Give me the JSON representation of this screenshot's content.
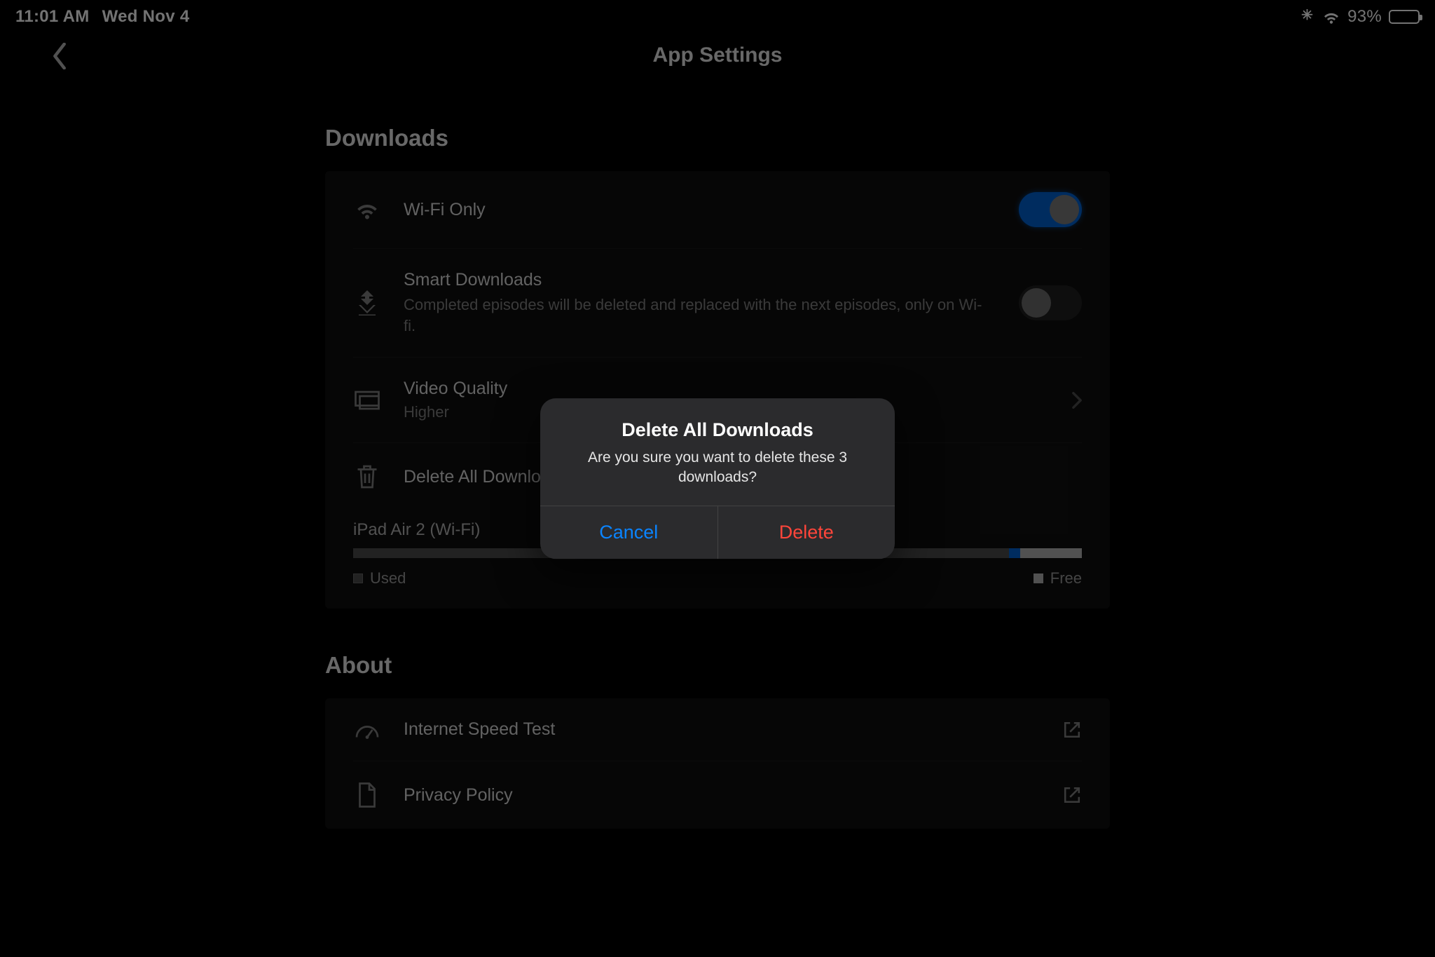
{
  "status": {
    "time": "11:01 AM",
    "date": "Wed Nov 4",
    "battery_pct": "93%"
  },
  "header": {
    "title": "App Settings"
  },
  "sections": {
    "downloads": {
      "title": "Downloads",
      "wifi": {
        "label": "Wi-Fi Only"
      },
      "smart": {
        "label": "Smart Downloads",
        "desc": "Completed episodes will be deleted and replaced with the next episodes, only on Wi-fi."
      },
      "quality": {
        "label": "Video Quality",
        "value": "Higher"
      },
      "delete": {
        "label": "Delete All Downloads"
      },
      "storage": {
        "device": "iPad Air 2 (Wi-Fi)",
        "legend_used": "Used",
        "legend_free": "Free"
      }
    },
    "about": {
      "title": "About",
      "speed": {
        "label": "Internet Speed Test"
      },
      "privacy": {
        "label": "Privacy Policy"
      }
    }
  },
  "modal": {
    "title": "Delete All Downloads",
    "message": "Are you sure you want to delete these 3 downloads?",
    "cancel": "Cancel",
    "delete": "Delete"
  }
}
